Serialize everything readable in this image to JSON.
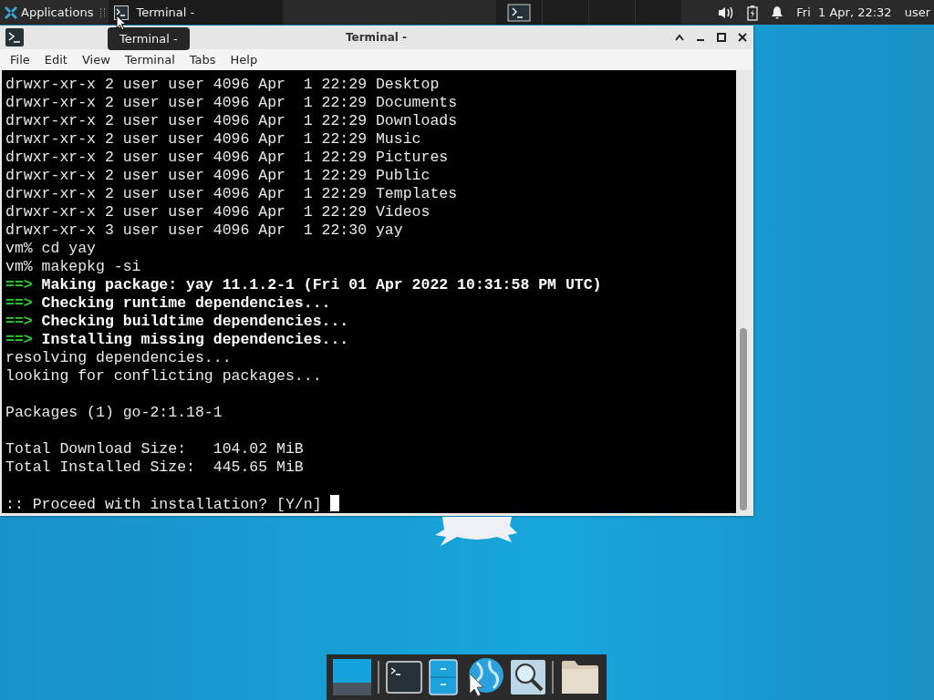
{
  "top_panel": {
    "apps_menu": "Applications",
    "task": {
      "title": "Terminal -",
      "selected": true
    },
    "clock": "Fri  1 Apr, 22:32",
    "user": "user"
  },
  "tooltip": "Terminal -",
  "window": {
    "title": "Terminal -",
    "menu": [
      "File",
      "Edit",
      "View",
      "Terminal",
      "Tabs",
      "Help"
    ],
    "lines": [
      {
        "kind": "plain",
        "text": "drwxr-xr-x 2 user user 4096 Apr  1 22:29 Desktop"
      },
      {
        "kind": "plain",
        "text": "drwxr-xr-x 2 user user 4096 Apr  1 22:29 Documents"
      },
      {
        "kind": "plain",
        "text": "drwxr-xr-x 2 user user 4096 Apr  1 22:29 Downloads"
      },
      {
        "kind": "plain",
        "text": "drwxr-xr-x 2 user user 4096 Apr  1 22:29 Music"
      },
      {
        "kind": "plain",
        "text": "drwxr-xr-x 2 user user 4096 Apr  1 22:29 Pictures"
      },
      {
        "kind": "plain",
        "text": "drwxr-xr-x 2 user user 4096 Apr  1 22:29 Public"
      },
      {
        "kind": "plain",
        "text": "drwxr-xr-x 2 user user 4096 Apr  1 22:29 Templates"
      },
      {
        "kind": "plain",
        "text": "drwxr-xr-x 2 user user 4096 Apr  1 22:29 Videos"
      },
      {
        "kind": "plain",
        "text": "drwxr-xr-x 3 user user 4096 Apr  1 22:30 yay"
      },
      {
        "kind": "plain",
        "text": "vm% cd yay"
      },
      {
        "kind": "plain",
        "text": "vm% makepkg -si"
      },
      {
        "kind": "status",
        "marker": "==>",
        "text": "Making package: yay 11.1.2-1 (Fri 01 Apr 2022 10:31:58 PM UTC)"
      },
      {
        "kind": "status",
        "marker": "==>",
        "text": "Checking runtime dependencies..."
      },
      {
        "kind": "status",
        "marker": "==>",
        "text": "Checking buildtime dependencies..."
      },
      {
        "kind": "status",
        "marker": "==>",
        "text": "Installing missing dependencies..."
      },
      {
        "kind": "plain",
        "text": "resolving dependencies..."
      },
      {
        "kind": "plain",
        "text": "looking for conflicting packages..."
      },
      {
        "kind": "blank"
      },
      {
        "kind": "plain",
        "text": "Packages (1) go-2:1.18-1"
      },
      {
        "kind": "blank"
      },
      {
        "kind": "plain",
        "text": "Total Download Size:   104.02 MiB"
      },
      {
        "kind": "plain",
        "text": "Total Installed Size:  445.65 MiB"
      },
      {
        "kind": "blank"
      },
      {
        "kind": "input",
        "text": ":: Proceed with installation? [Y/n]"
      }
    ]
  },
  "dock": [
    {
      "kind": "desktop"
    },
    {
      "kind": "terminal"
    },
    {
      "kind": "files"
    },
    {
      "kind": "browser"
    },
    {
      "kind": "search"
    },
    {
      "kind": "folder"
    }
  ]
}
